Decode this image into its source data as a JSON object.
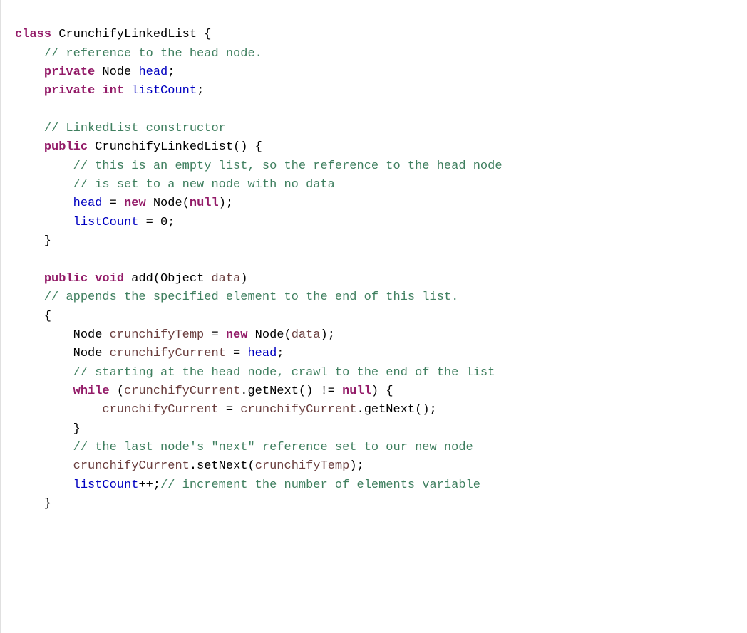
{
  "code": {
    "0": {
      "t0": "class",
      "t1": " CrunchifyLinkedList {"
    },
    "1": {
      "t0": "    ",
      "t1": "// reference to the head node."
    },
    "2": {
      "t0": "    ",
      "t1": "private",
      "t2": " Node ",
      "t3": "head",
      "t4": ";"
    },
    "3": {
      "t0": "    ",
      "t1": "private",
      "t2": " ",
      "t3": "int",
      "t4": " ",
      "t5": "listCount",
      "t6": ";"
    },
    "4": {
      "t0": " "
    },
    "5": {
      "t0": "    ",
      "t1": "// LinkedList constructor"
    },
    "6": {
      "t0": "    ",
      "t1": "public",
      "t2": " CrunchifyLinkedList() {"
    },
    "7": {
      "t0": "        ",
      "t1": "// this is an empty list, so the reference to the head node"
    },
    "8": {
      "t0": "        ",
      "t1": "// is set to a new node with no data"
    },
    "9": {
      "t0": "        ",
      "t1": "head",
      "t2": " = ",
      "t3": "new",
      "t4": " Node(",
      "t5": "null",
      "t6": ");"
    },
    "10": {
      "t0": "        ",
      "t1": "listCount",
      "t2": " = 0;"
    },
    "11": {
      "t0": "    }"
    },
    "12": {
      "t0": " "
    },
    "13": {
      "t0": "    ",
      "t1": "public",
      "t2": " ",
      "t3": "void",
      "t4": " add(Object ",
      "t5": "data",
      "t6": ")"
    },
    "14": {
      "t0": "    ",
      "t1": "// appends the specified element to the end of this list."
    },
    "15": {
      "t0": "    {"
    },
    "16": {
      "t0": "        Node ",
      "t1": "crunchifyTemp",
      "t2": " = ",
      "t3": "new",
      "t4": " Node(",
      "t5": "data",
      "t6": ");"
    },
    "17": {
      "t0": "        Node ",
      "t1": "crunchifyCurrent",
      "t2": " = ",
      "t3": "head",
      "t4": ";"
    },
    "18": {
      "t0": "        ",
      "t1": "// starting at the head node, crawl to the end of the list"
    },
    "19": {
      "t0": "        ",
      "t1": "while",
      "t2": " (",
      "t3": "crunchifyCurrent",
      "t4": ".getNext() != ",
      "t5": "null",
      "t6": ") {"
    },
    "20": {
      "t0": "            ",
      "t1": "crunchifyCurrent",
      "t2": " = ",
      "t3": "crunchifyCurrent",
      "t4": ".getNext();"
    },
    "21": {
      "t0": "        }"
    },
    "22": {
      "t0": "        ",
      "t1": "// the last node's \"next\" reference set to our new node"
    },
    "23": {
      "t0": "        ",
      "t1": "crunchifyCurrent",
      "t2": ".setNext(",
      "t3": "crunchifyTemp",
      "t4": ");"
    },
    "24": {
      "t0": "        ",
      "t1": "listCount",
      "t2": "++;",
      "t3": "// increment the number of elements variable"
    },
    "25": {
      "t0": "    }"
    }
  }
}
